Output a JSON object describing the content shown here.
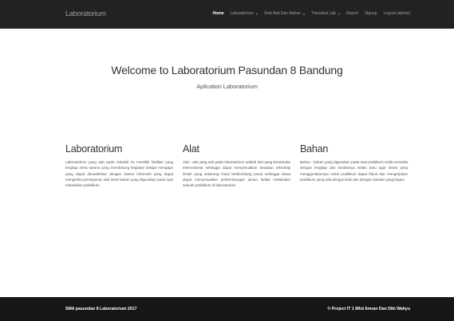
{
  "navbar": {
    "brand": "Laboratorium",
    "items": [
      {
        "label": "Home",
        "active": true,
        "dropdown": false
      },
      {
        "label": "Laboratorium",
        "active": false,
        "dropdown": true
      },
      {
        "label": "Stok Alat Dan Bahan",
        "active": false,
        "dropdown": true
      },
      {
        "label": "Transaksi Lab",
        "active": false,
        "dropdown": true
      },
      {
        "label": "Report",
        "active": false,
        "dropdown": false
      },
      {
        "label": "Signup",
        "active": false,
        "dropdown": false
      },
      {
        "label": "Logout (admin)",
        "active": false,
        "dropdown": false
      }
    ]
  },
  "hero": {
    "title": "Welcome to Laboratorium Pasundan 8 Bandung",
    "subtitle": "Aplication Laboratorium"
  },
  "columns": [
    {
      "heading": "Laboratorium",
      "text": "Laboratorium yang ada pada sekolah ini memiliki fasilitas yang lengkap serta sarana yang mendukung kegiatan belajar mengajar yang dapat dimudahkan dengan sistem informasi yang dapat mengelola peminjaman alat serta bahan yang digunakan pada saat melakukan praktikum."
    },
    {
      "heading": "Alat",
      "text": "Alat - alat yang ada pada laboratorium adalah alat yang berstandar internasional sehingga dapat menyesuaikan keadaan teknologi ilmiah yang sekarang mulai berkembang pesat sehingga siswa dapat menyesuaikan perkembangan jaman ketika melakukan sebuah praktikum di laboratorium."
    },
    {
      "heading": "Bahan",
      "text": "Bahan - bahan yang digunakan pada saat praktikum selalu tersedia dengan lengkap dan kondisinya selalu baru agar siswa yang menggunakannya untuk praktikum dapat fokus dan mengerjakan praktikum yang ada dengan baik dan dengan standar yang bagus."
    }
  ],
  "footer": {
    "left": "SMA pasundan 8 Laboratorium 2017",
    "right": "© Project IT 1 Mhd Amran Dan Diki Wahyu"
  },
  "colors": {
    "navbar_bg": "#222222",
    "footer_bg": "#161616",
    "nav_text": "#9d9d9d"
  }
}
